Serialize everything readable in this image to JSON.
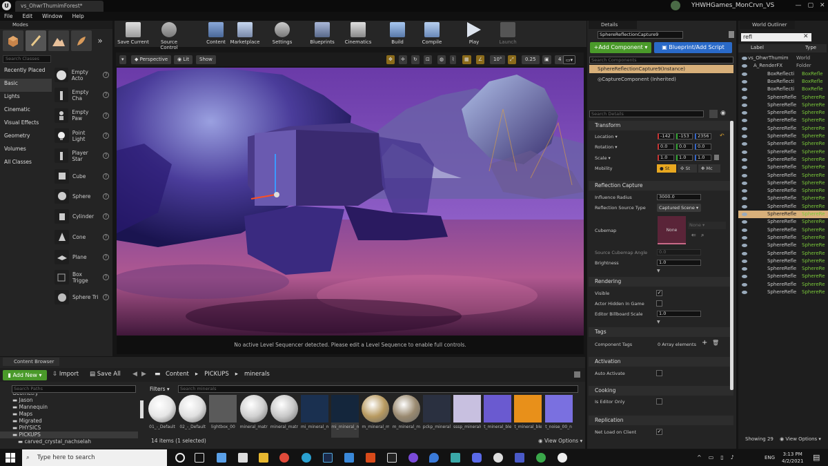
{
  "titlebar": {
    "doc_tab": "vs_OhwrThumimForest*",
    "user": "YHWHGames_MonCrvn_VS"
  },
  "menu": [
    "File",
    "Edit",
    "Window",
    "Help"
  ],
  "modes": {
    "title": "Modes",
    "search_placeholder": "Search Classes",
    "categories": [
      "Recently Placed",
      "Basic",
      "Lights",
      "Cinematic",
      "Visual Effects",
      "Geometry",
      "Volumes",
      "All Classes"
    ],
    "selected_category": "Basic",
    "items": [
      "Empty Acto",
      "Empty Cha",
      "Empty Paw",
      "Point Light",
      "Player Star",
      "Cube",
      "Sphere",
      "Cylinder",
      "Cone",
      "Plane",
      "Box Trigge",
      "Sphere Tri"
    ]
  },
  "toolbar": {
    "buttons": [
      {
        "label": "Save Current",
        "icon": "save-icon"
      },
      {
        "label": "Source Control",
        "icon": "source-control-icon"
      },
      {
        "label": "Content",
        "icon": "content-icon"
      },
      {
        "label": "Marketplace",
        "icon": "marketplace-icon"
      },
      {
        "label": "Settings",
        "icon": "settings-icon"
      },
      {
        "label": "Blueprints",
        "icon": "blueprints-icon"
      },
      {
        "label": "Cinematics",
        "icon": "cinematics-icon"
      },
      {
        "label": "Build",
        "icon": "build-icon"
      },
      {
        "label": "Compile",
        "icon": "compile-icon"
      },
      {
        "label": "Play",
        "icon": "play-icon"
      },
      {
        "label": "Launch",
        "icon": "launch-icon"
      }
    ]
  },
  "viewport": {
    "perspective": "Perspective",
    "lit": "Lit",
    "show": "Show",
    "angle": "10°",
    "scale": "0.25",
    "camera_speed": "4",
    "message": "No active Level Sequencer detected. Please edit a Level Sequence to enable full controls."
  },
  "details": {
    "title": "Details",
    "actor_name": "SphereReflectionCapture9",
    "add_component": "+Add Component ▾",
    "blueprint_script": "Blueprint/Add Script",
    "search_components": "Search Components",
    "instance_item": "SphereReflectionCapture9(Instance)",
    "capture_component": "CaptureComponent (Inherited)",
    "search_details": "Search Details",
    "sections": {
      "transform": "Transform",
      "reflection_capture": "Reflection Capture",
      "rendering": "Rendering",
      "tags": "Tags",
      "activation": "Activation",
      "cooking": "Cooking",
      "replication": "Replication"
    },
    "transform": {
      "location_label": "Location ▾",
      "location": [
        "-142",
        "-153",
        "2356"
      ],
      "rotation_label": "Rotation ▾",
      "rotation": [
        "0.0",
        "0.0",
        "0.0"
      ],
      "scale_label": "Scale ▾",
      "scale": [
        "1.0",
        "1.0",
        "1.0"
      ],
      "mobility_label": "Mobility",
      "mobility": [
        "St",
        "St",
        "Mc"
      ]
    },
    "reflection": {
      "influence_radius_label": "Influence Radius",
      "influence_radius": "3000.0",
      "source_type_label": "Reflection Source Type",
      "source_type": "Captured Scene",
      "cubemap_label": "Cubemap",
      "cubemap_value": "None",
      "cubemap_dropdown": "None",
      "source_angle_label": "Source Cubemap Angle",
      "source_angle": "0.0",
      "brightness_label": "Brightness",
      "brightness": "1.0"
    },
    "rendering": {
      "visible_label": "Visible",
      "actor_hidden_label": "Actor Hidden In Game",
      "billboard_scale_label": "Editor Billboard Scale",
      "billboard_scale": "1.0"
    },
    "tags": {
      "component_tags_label": "Component Tags",
      "array_elements": "0 Array elements"
    },
    "activation": {
      "auto_activate_label": "Auto Activate"
    },
    "cooking": {
      "is_editor_only_label": "Is Editor Only"
    },
    "replication": {
      "net_load_label": "Net Load on Client"
    }
  },
  "outliner": {
    "title": "World Outliner",
    "search": "refl",
    "col_label": "Label",
    "col_type": "Type",
    "rows": [
      {
        "label": "vs_OhwrThumim",
        "type": "World"
      },
      {
        "label": "A_RenderFX",
        "type": "Folder"
      },
      {
        "label": "BoxReflecti",
        "type": "BoxRefle"
      },
      {
        "label": "BoxReflecti",
        "type": "BoxRefle"
      },
      {
        "label": "BoxReflecti",
        "type": "BoxRefle"
      },
      {
        "label": "SphereRefle",
        "type": "SphereRe"
      },
      {
        "label": "SphereRefle",
        "type": "SphereRe"
      },
      {
        "label": "SphereRefle",
        "type": "SphereRe"
      },
      {
        "label": "SphereRefle",
        "type": "SphereRe"
      },
      {
        "label": "SphereRefle",
        "type": "SphereRe"
      },
      {
        "label": "SphereRefle",
        "type": "SphereRe"
      },
      {
        "label": "SphereRefle",
        "type": "SphereRe"
      },
      {
        "label": "SphereRefle",
        "type": "SphereRe"
      },
      {
        "label": "SphereRefle",
        "type": "SphereRe"
      },
      {
        "label": "SphereRefle",
        "type": "SphereRe"
      },
      {
        "label": "SphereRefle",
        "type": "SphereRe"
      },
      {
        "label": "SphereRefle",
        "type": "SphereRe"
      },
      {
        "label": "SphereRefle",
        "type": "SphereRe"
      },
      {
        "label": "SphereRefle",
        "type": "SphereRe"
      },
      {
        "label": "SphereRefle",
        "type": "SphereRe"
      },
      {
        "label": "SphereRefle",
        "type": "SphereRe"
      },
      {
        "label": "SphereRefle",
        "type": "SphereRe"
      },
      {
        "label": "SphereRefle",
        "type": "SphereRe"
      },
      {
        "label": "SphereRefle",
        "type": "SphereRe"
      },
      {
        "label": "SphereRefle",
        "type": "SphereRe"
      },
      {
        "label": "SphereRefle",
        "type": "SphereRe"
      },
      {
        "label": "SphereRefle",
        "type": "SphereRe"
      },
      {
        "label": "SphereRefle",
        "type": "SphereRe"
      },
      {
        "label": "SphereRefle",
        "type": "SphereRe"
      },
      {
        "label": "SphereRefle",
        "type": "SphereRe"
      },
      {
        "label": "SphereRefle",
        "type": "SphereRe"
      }
    ],
    "selected_row": 20,
    "footer_count": "Showing 29",
    "view_options": "View Options ▾"
  },
  "content_browser": {
    "tab": "Content Browser",
    "add_new": "Add New ▾",
    "import": "Import",
    "save_all": "Save All",
    "path": [
      "Content",
      "PICKUPS",
      "minerals"
    ],
    "search_paths": "Search Paths",
    "filters": "Filters ▾",
    "search_minerals": "Search minerals",
    "tree": [
      "Geometry",
      "Jason",
      "Mannequin",
      "Maps",
      "Migrated",
      "PHYSICS",
      "PICKUPS",
      "carved_crystal_nachselah"
    ],
    "assets": [
      {
        "name": "01_-_Default",
        "color": "#e6e6e6"
      },
      {
        "name": "02_-_Default",
        "color": "#e0e0e0"
      },
      {
        "name": "lightbox_00",
        "color": "#5a5a5a"
      },
      {
        "name": "mineral_matrix_cube",
        "color": "#d0d0d0"
      },
      {
        "name": "mineral_matrix_cube",
        "color": "#c8c8c8"
      },
      {
        "name": "mi_mineral_matrix_cube",
        "color": "#1a3050"
      },
      {
        "name": "mi_mineral_matrix_cube",
        "color": "#14263c"
      },
      {
        "name": "m_mineral_matrix_cube",
        "color": "#b89a60"
      },
      {
        "name": "m_mineral_matrix_cube",
        "color": "#9a8a70"
      },
      {
        "name": "pckp_mineral_matrix_cube",
        "color": "#2a3040"
      },
      {
        "name": "sssp_minerals",
        "color": "#c8c0e0"
      },
      {
        "name": "t_mineral_blend_00_n",
        "color": "#6a5ad0"
      },
      {
        "name": "t_mineral_blend_00",
        "color": "#e8901a"
      },
      {
        "name": "t_noise_00_n",
        "color": "#7a70e0"
      }
    ],
    "status": "14 items (1 selected)",
    "view_options": "View Options ▾"
  },
  "taskbar": {
    "search": "Type here to search",
    "lang": "ENG",
    "time": "3:13 PM",
    "date": "4/2/2021"
  }
}
